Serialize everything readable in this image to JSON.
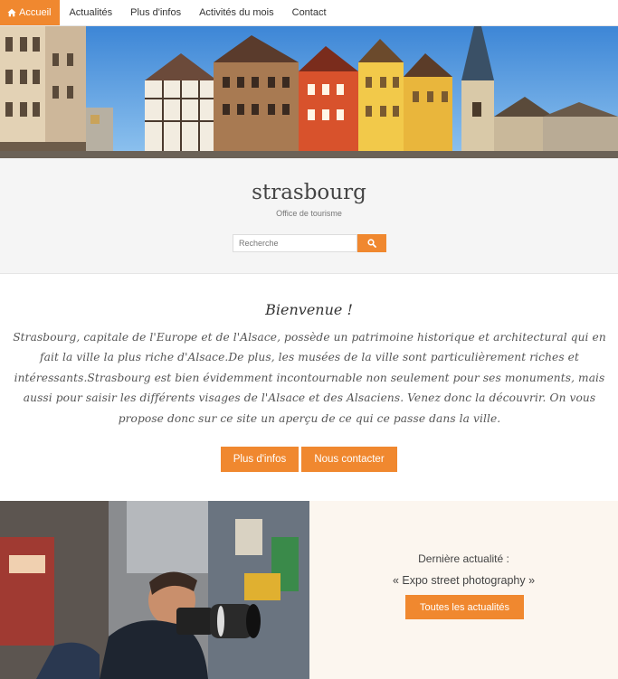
{
  "nav": {
    "items": [
      {
        "label": "Accueil",
        "active": true
      },
      {
        "label": "Actualités"
      },
      {
        "label": "Plus d'infos"
      },
      {
        "label": "Activités du mois"
      },
      {
        "label": "Contact"
      }
    ]
  },
  "header": {
    "title": "strasbourg",
    "subtitle": "Office de tourisme"
  },
  "search": {
    "placeholder": "Recherche"
  },
  "welcome": {
    "title": "Bienvenue !",
    "text": "Strasbourg, capitale de l'Europe et de l'Alsace, possède un patrimoine historique et architectural qui en fait la ville la plus riche d'Alsace.De plus, les musées de la ville sont particulièrement riches et intéressants.Strasbourg est bien évidemment incontournable non seulement pour ses monuments, mais aussi pour saisir les différents visages de l'Alsace et des Alsaciens. Venez donc la découvrir. On vous propose donc sur ce site un aperçu de ce qui ce passe dans la ville.",
    "buttons": {
      "infos": "Plus d'infos",
      "contact": "Nous contacter"
    }
  },
  "news": {
    "label": "Dernière actualité :",
    "latest": "« Expo street photography »",
    "button": "Toutes les actualités"
  },
  "colors": {
    "accent": "#f0882f",
    "band": "#f5f5f5",
    "news_panel": "#fcf6ef"
  },
  "icons": {
    "home": "home-icon",
    "search": "search-icon"
  }
}
